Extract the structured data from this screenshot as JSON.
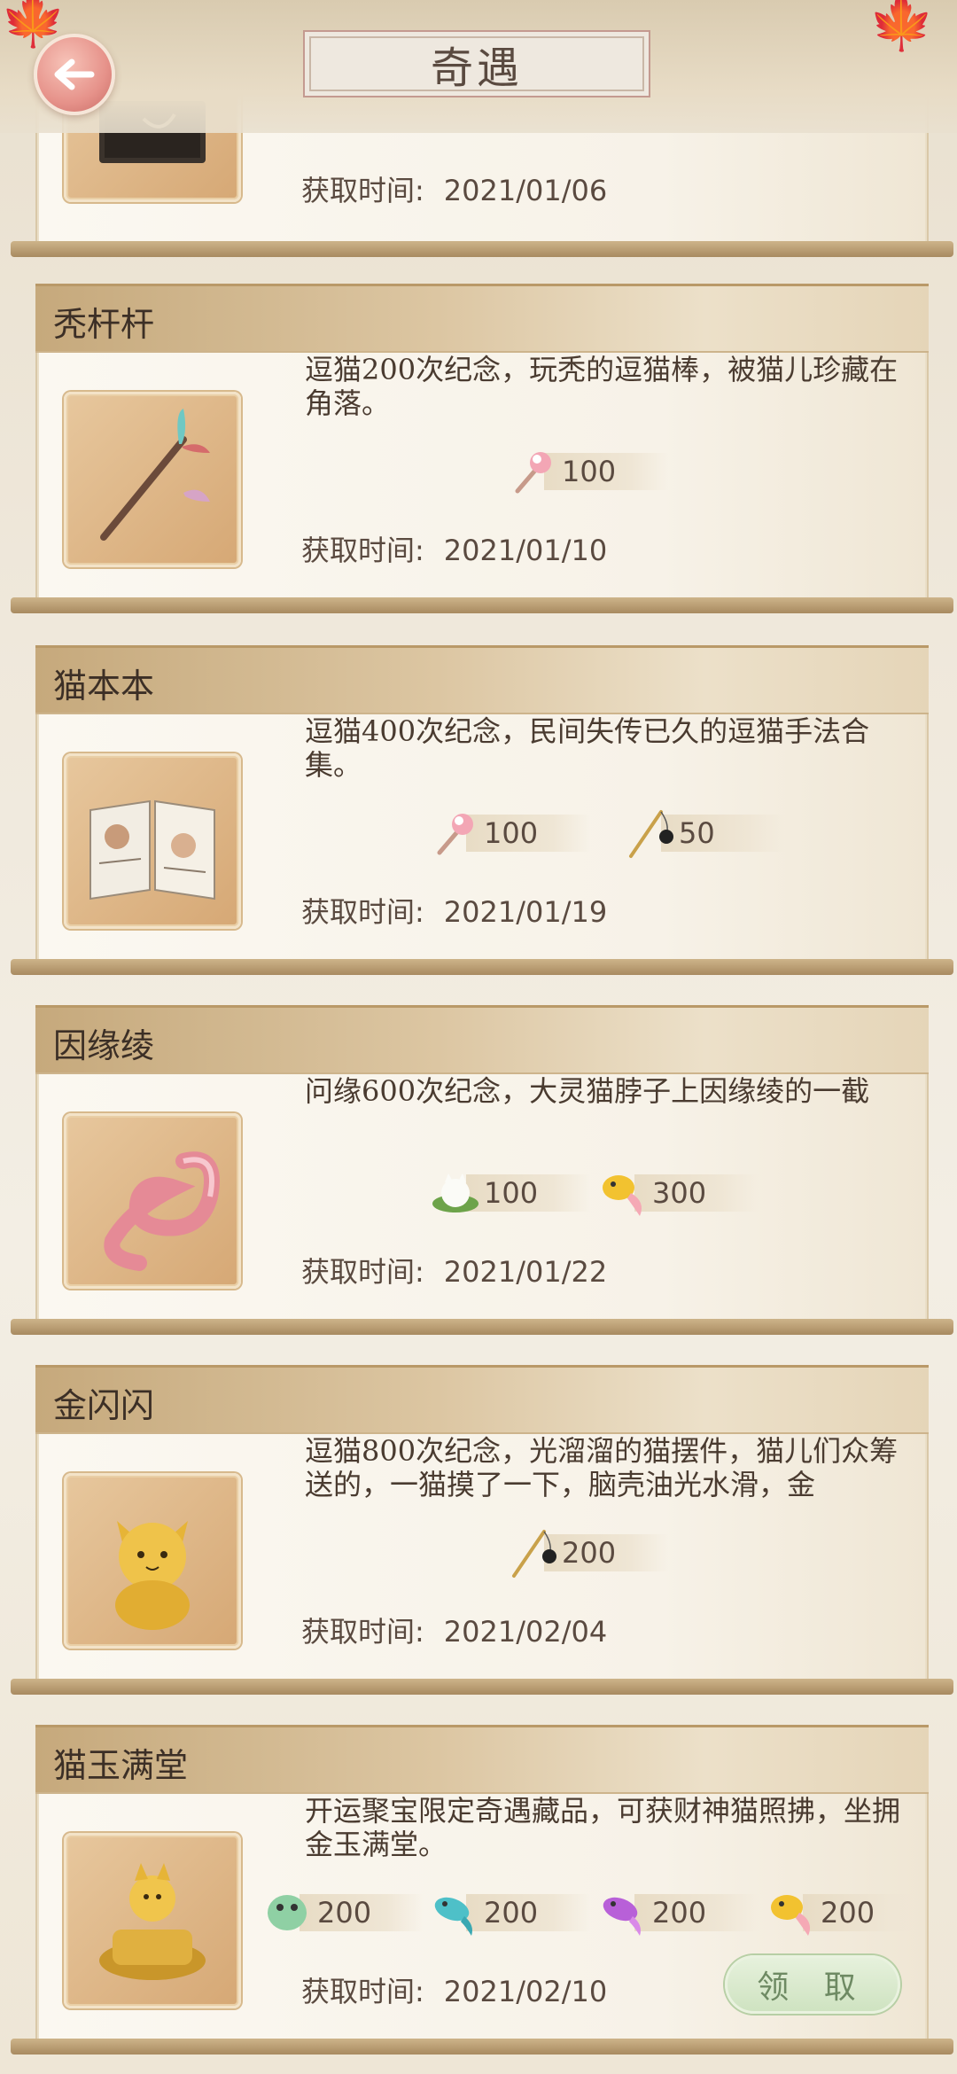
{
  "header": {
    "title": "奇遇"
  },
  "obtained_label": "获取时间:",
  "claim_label": "领 取",
  "cards": [
    {
      "name": "",
      "desc": "",
      "date": "2021/01/06",
      "rewards": []
    },
    {
      "name": "秃杆杆",
      "desc": "逗猫200次纪念，玩秃的逗猫棒，被猫儿珍藏在角落。",
      "date": "2021/01/10",
      "rewards": [
        {
          "icon": "fluffy-wand-icon",
          "value": "100"
        }
      ]
    },
    {
      "name": "猫本本",
      "desc": "逗猫400次纪念，民间失传已久的逗猫手法合集。",
      "date": "2021/01/19",
      "rewards": [
        {
          "icon": "fluffy-wand-icon",
          "value": "100"
        },
        {
          "icon": "fishing-rod-icon",
          "value": "50"
        }
      ]
    },
    {
      "name": "因缘绫",
      "desc": "问缘600次纪念，大灵猫脖子上因缘绫的一截",
      "date": "2021/01/22",
      "rewards": [
        {
          "icon": "rice-cat-icon",
          "value": "100"
        },
        {
          "icon": "gold-fish-icon",
          "value": "300"
        }
      ]
    },
    {
      "name": "金闪闪",
      "desc": "逗猫800次纪念，光溜溜的猫摆件，猫儿们众筹送的，一猫摸了一下，脑壳油光水滑，金",
      "date": "2021/02/04",
      "rewards": [
        {
          "icon": "fishing-rod-icon",
          "value": "200"
        }
      ]
    },
    {
      "name": "猫玉满堂",
      "desc": "开运聚宝限定奇遇藏品，可获财神猫照拂，坐拥金玉满堂。",
      "date": "2021/02/10",
      "rewards": [
        {
          "icon": "green-fish-icon",
          "value": "200"
        },
        {
          "icon": "blue-fish-icon",
          "value": "200"
        },
        {
          "icon": "purple-fish-icon",
          "value": "200"
        },
        {
          "icon": "gold-fish-icon",
          "value": "200"
        }
      ]
    }
  ]
}
